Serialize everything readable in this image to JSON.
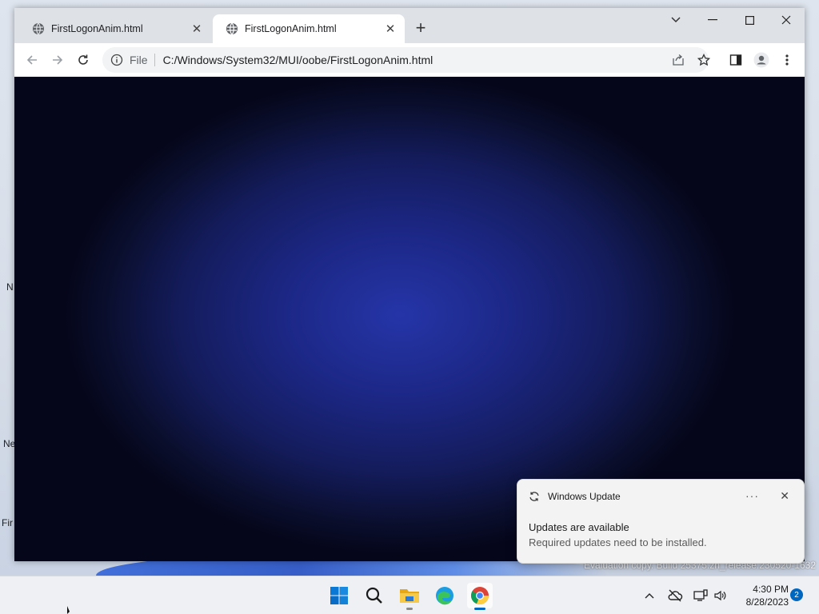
{
  "browser": {
    "tabs": [
      {
        "label": "FirstLogonAnim.html",
        "active": false
      },
      {
        "label": "FirstLogonAnim.html",
        "active": true
      }
    ],
    "address": {
      "scheme_label": "File",
      "url": "C:/Windows/System32/MUI/oobe/FirstLogonAnim.html"
    }
  },
  "desktop": {
    "icon_fragments": [
      "N",
      "Ne",
      "Fir"
    ],
    "watermark": "Evaluation copy. Build 25375.zn_release.230520-1632"
  },
  "toast": {
    "app_name": "Windows Update",
    "more_label": "···",
    "title": "Updates are available",
    "body": "Required updates need to be installed."
  },
  "taskbar": {
    "apps": [
      "start-icon",
      "search-icon",
      "file-explorer-icon",
      "edge-icon",
      "chrome-icon"
    ],
    "time": "4:30 PM",
    "date": "8/28/2023",
    "notification_count": "2"
  },
  "colors": {
    "accent": "#0067c0",
    "viewport_center": "#2535a8",
    "viewport_edge": "#05061a"
  }
}
